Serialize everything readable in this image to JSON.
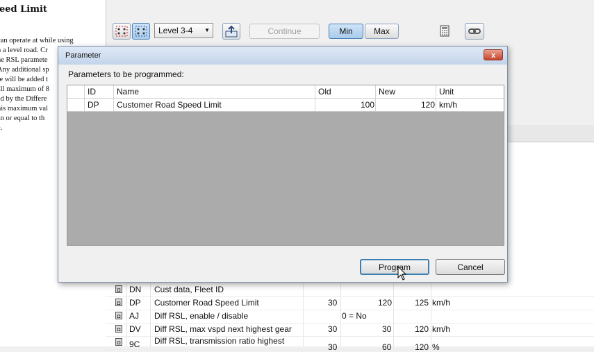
{
  "help": {
    "title": "eed Limit",
    "lines": [
      "can operate at while using",
      "n a level road. Cr",
      "he RSL paramete",
      "Any additional sp",
      "re will be added t",
      "all maximum of 8",
      "ed by the Differe",
      "his maximum val",
      "an or equal to th",
      "e."
    ]
  },
  "toolbar": {
    "level_select": "Level 3-4",
    "continue_label": "Continue",
    "min_label": "Min",
    "max_label": "Max",
    "icons": [
      "grid-icon-1",
      "grid-icon-2",
      "upload-icon",
      "calculator-icon",
      "link-icon"
    ]
  },
  "background_table": {
    "rows": [
      {
        "id": "DN",
        "name": "Cust data, Fleet ID",
        "old": "",
        "min": "",
        "value": "",
        "max": "",
        "unit": ""
      },
      {
        "id": "DP",
        "name": "Customer Road Speed Limit",
        "old": "30",
        "min": "",
        "value": "120",
        "max": "125",
        "unit": "km/h"
      },
      {
        "id": "AJ",
        "name": "Diff RSL, enable / disable",
        "old": "",
        "min": "0 = No",
        "value": "",
        "max": "",
        "unit": ""
      },
      {
        "id": "DV",
        "name": "Diff RSL, max vspd next highest gear",
        "old": "30",
        "min": "",
        "value": "30",
        "max": "120",
        "unit": "km/h"
      },
      {
        "id": "9C",
        "name": "Diff RSL, transmission ratio highest",
        "old": "30",
        "min": "",
        "value": "60",
        "max": "120",
        "unit": "%"
      }
    ]
  },
  "dialog": {
    "title": "Parameter",
    "label": "Parameters to be programmed:",
    "columns": {
      "id": "ID",
      "name": "Name",
      "old": "Old",
      "new": "New",
      "unit": "Unit"
    },
    "row": {
      "id": "DP",
      "name": "Customer Road Speed Limit",
      "old": "100",
      "new": "120",
      "unit": "km/h"
    },
    "program_label": "Program",
    "cancel_label": "Cancel",
    "close_glyph": "x"
  }
}
